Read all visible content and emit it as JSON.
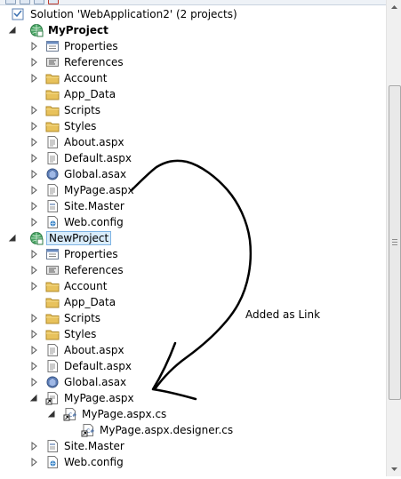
{
  "tree": [
    {
      "depth": 0,
      "twisty": "none",
      "icon": "solution-icon",
      "label": "Solution 'WebApplication2' (2 projects)",
      "bold": false
    },
    {
      "depth": 0,
      "twisty": "expanded",
      "icon": "web-project-icon",
      "label": "MyProject",
      "bold": true
    },
    {
      "depth": 1,
      "twisty": "collapsed",
      "icon": "properties-icon",
      "label": "Properties"
    },
    {
      "depth": 1,
      "twisty": "collapsed",
      "icon": "references-icon",
      "label": "References"
    },
    {
      "depth": 1,
      "twisty": "collapsed",
      "icon": "folder-icon",
      "label": "Account"
    },
    {
      "depth": 1,
      "twisty": "none",
      "icon": "folder-icon",
      "label": "App_Data"
    },
    {
      "depth": 1,
      "twisty": "collapsed",
      "icon": "folder-icon",
      "label": "Scripts"
    },
    {
      "depth": 1,
      "twisty": "collapsed",
      "icon": "folder-icon",
      "label": "Styles"
    },
    {
      "depth": 1,
      "twisty": "collapsed",
      "icon": "aspx-page-icon",
      "label": "About.aspx"
    },
    {
      "depth": 1,
      "twisty": "collapsed",
      "icon": "aspx-page-icon",
      "label": "Default.aspx"
    },
    {
      "depth": 1,
      "twisty": "collapsed",
      "icon": "global-asax-icon",
      "label": "Global.asax"
    },
    {
      "depth": 1,
      "twisty": "collapsed",
      "icon": "aspx-page-icon",
      "label": "MyPage.aspx"
    },
    {
      "depth": 1,
      "twisty": "collapsed",
      "icon": "master-page-icon",
      "label": "Site.Master"
    },
    {
      "depth": 1,
      "twisty": "collapsed",
      "icon": "web-config-icon",
      "label": "Web.config"
    },
    {
      "depth": 0,
      "twisty": "expanded",
      "icon": "web-project-icon",
      "label": "NewProject",
      "selected": true
    },
    {
      "depth": 1,
      "twisty": "collapsed",
      "icon": "properties-icon",
      "label": "Properties"
    },
    {
      "depth": 1,
      "twisty": "collapsed",
      "icon": "references-icon",
      "label": "References"
    },
    {
      "depth": 1,
      "twisty": "collapsed",
      "icon": "folder-icon",
      "label": "Account"
    },
    {
      "depth": 1,
      "twisty": "none",
      "icon": "folder-icon",
      "label": "App_Data"
    },
    {
      "depth": 1,
      "twisty": "collapsed",
      "icon": "folder-icon",
      "label": "Scripts"
    },
    {
      "depth": 1,
      "twisty": "collapsed",
      "icon": "folder-icon",
      "label": "Styles"
    },
    {
      "depth": 1,
      "twisty": "collapsed",
      "icon": "aspx-page-icon",
      "label": "About.aspx"
    },
    {
      "depth": 1,
      "twisty": "collapsed",
      "icon": "aspx-page-icon",
      "label": "Default.aspx"
    },
    {
      "depth": 1,
      "twisty": "collapsed",
      "icon": "global-asax-icon",
      "label": "Global.asax"
    },
    {
      "depth": 1,
      "twisty": "expanded",
      "icon": "linked-aspx-page-icon",
      "label": "MyPage.aspx"
    },
    {
      "depth": 2,
      "twisty": "expanded",
      "icon": "linked-cs-file-icon",
      "label": "MyPage.aspx.cs"
    },
    {
      "depth": 3,
      "twisty": "none",
      "icon": "linked-cs-file-icon",
      "label": "MyPage.aspx.designer.cs"
    },
    {
      "depth": 1,
      "twisty": "collapsed",
      "icon": "master-page-icon",
      "label": "Site.Master"
    },
    {
      "depth": 1,
      "twisty": "collapsed",
      "icon": "web-config-icon",
      "label": "Web.config"
    }
  ],
  "annotation": {
    "text": "Added as Link",
    "ink_color": "#000000"
  },
  "colors": {
    "folder": "#e8c25c",
    "selection_bg": "#d9ecfb",
    "selection_border": "#7fb4e4",
    "twisty": "#555555"
  }
}
